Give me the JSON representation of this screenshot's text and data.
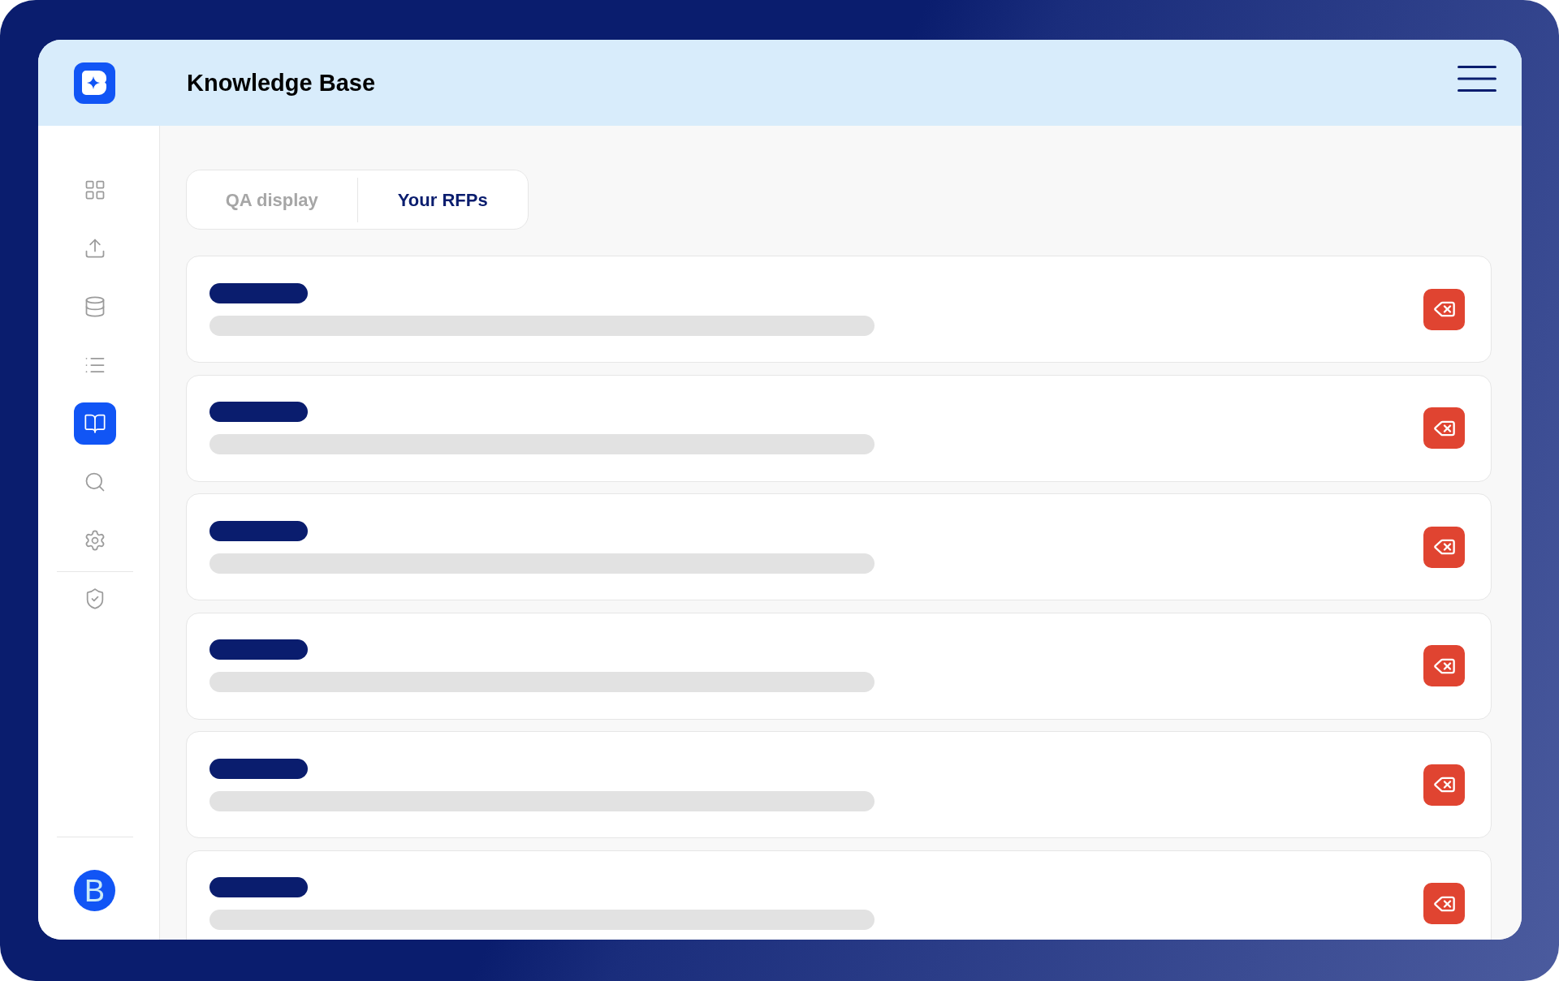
{
  "header": {
    "title": "Knowledge Base"
  },
  "sidebar": {
    "items": [
      {
        "selected": false
      },
      {
        "selected": false
      },
      {
        "selected": false
      },
      {
        "selected": false
      },
      {
        "selected": true
      },
      {
        "selected": false
      },
      {
        "selected": false
      }
    ],
    "secondary_items": [
      {
        "selected": false
      }
    ],
    "avatar": {
      "initial": "B"
    }
  },
  "tabs": [
    {
      "label": "QA display",
      "selected": false
    },
    {
      "label": "Your RFPs",
      "selected": true
    }
  ],
  "cards": [
    {
      "kind": "placeholder"
    },
    {
      "kind": "placeholder"
    },
    {
      "kind": "placeholder"
    },
    {
      "kind": "placeholder"
    },
    {
      "kind": "placeholder"
    },
    {
      "kind": "placeholder"
    }
  ]
}
